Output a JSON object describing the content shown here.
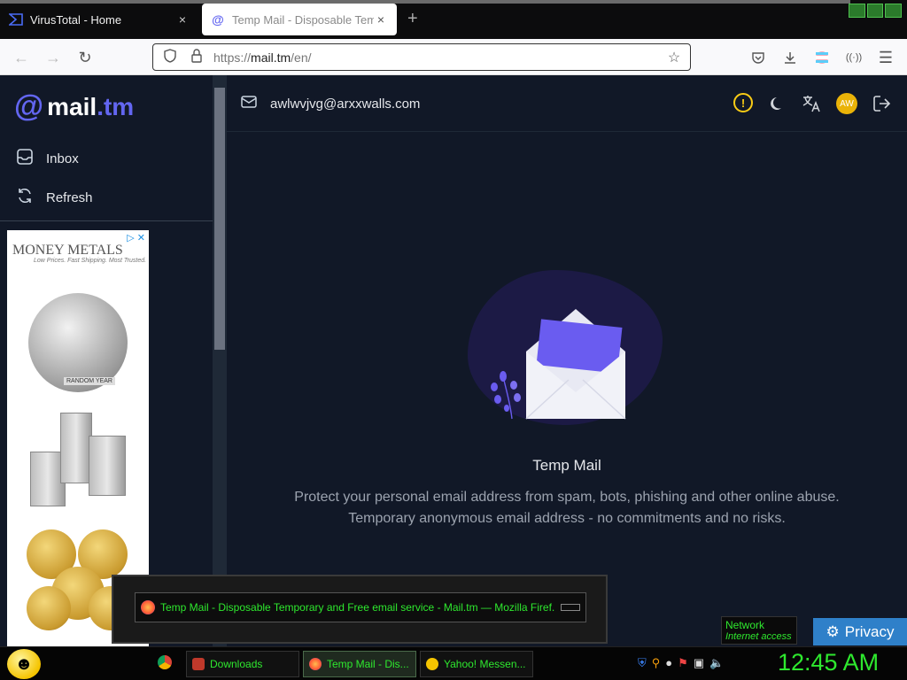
{
  "browser": {
    "tabs": [
      {
        "label": "VirusTotal - Home",
        "favicon": "virustotal-icon",
        "close": "×"
      },
      {
        "label": "Temp Mail - Disposable Tempo",
        "favicon": "at-sign-icon",
        "close": "×"
      }
    ],
    "new_tab": "+",
    "url_prefix": "https://",
    "url_host": "mail.tm",
    "url_path": "/en/"
  },
  "sidebar": {
    "logo_mark": "@",
    "logo_text": "mail",
    "logo_tld": ".tm",
    "items": [
      {
        "label": "Inbox",
        "icon": "inbox-icon"
      },
      {
        "label": "Refresh",
        "icon": "refresh-icon"
      }
    ]
  },
  "ad": {
    "brand": "MONEY METALS",
    "tagline": "Low Prices. Fast Shipping. Most Trusted.",
    "coin_label": "RANDOM YEAR"
  },
  "header": {
    "email": "awlwvjvg@arxxwalls.com",
    "avatar_initials": "AW"
  },
  "hero": {
    "title": "Temp Mail",
    "line1": "Protect your personal email address from spam, bots, phishing and other online abuse.",
    "line2": "Temporary anonymous email address - no commitments and no risks."
  },
  "overlay": {
    "window_title": "Temp Mail - Disposable Temporary and Free email service - Mail.tm — Mozilla Firef..."
  },
  "network": {
    "title": "Network",
    "status": "Internet access"
  },
  "privacy": {
    "label": "Privacy"
  },
  "taskbar": {
    "items": [
      {
        "label": "Downloads"
      },
      {
        "label": "Temp Mail - Dis..."
      },
      {
        "label": "Yahoo! Messen..."
      }
    ],
    "clock": "12:45 AM"
  },
  "colors": {
    "accent": "#6366f1",
    "page_bg": "#111827",
    "taskbar_text": "#2ee82e",
    "privacy_bg": "#2f80c9"
  }
}
